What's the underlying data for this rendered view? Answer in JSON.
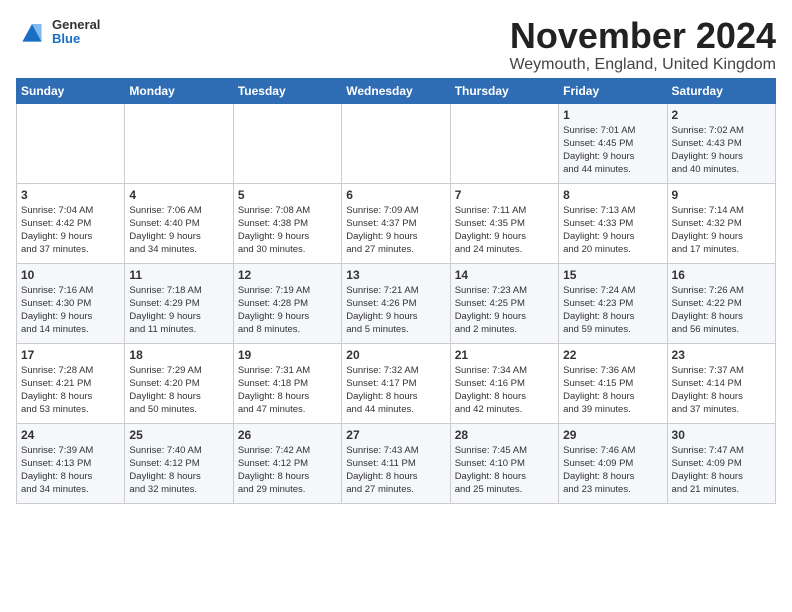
{
  "logo": {
    "general": "General",
    "blue": "Blue"
  },
  "header": {
    "month": "November 2024",
    "location": "Weymouth, England, United Kingdom"
  },
  "weekdays": [
    "Sunday",
    "Monday",
    "Tuesday",
    "Wednesday",
    "Thursday",
    "Friday",
    "Saturday"
  ],
  "rows": [
    [
      {
        "day": "",
        "info": ""
      },
      {
        "day": "",
        "info": ""
      },
      {
        "day": "",
        "info": ""
      },
      {
        "day": "",
        "info": ""
      },
      {
        "day": "",
        "info": ""
      },
      {
        "day": "1",
        "info": "Sunrise: 7:01 AM\nSunset: 4:45 PM\nDaylight: 9 hours\nand 44 minutes."
      },
      {
        "day": "2",
        "info": "Sunrise: 7:02 AM\nSunset: 4:43 PM\nDaylight: 9 hours\nand 40 minutes."
      }
    ],
    [
      {
        "day": "3",
        "info": "Sunrise: 7:04 AM\nSunset: 4:42 PM\nDaylight: 9 hours\nand 37 minutes."
      },
      {
        "day": "4",
        "info": "Sunrise: 7:06 AM\nSunset: 4:40 PM\nDaylight: 9 hours\nand 34 minutes."
      },
      {
        "day": "5",
        "info": "Sunrise: 7:08 AM\nSunset: 4:38 PM\nDaylight: 9 hours\nand 30 minutes."
      },
      {
        "day": "6",
        "info": "Sunrise: 7:09 AM\nSunset: 4:37 PM\nDaylight: 9 hours\nand 27 minutes."
      },
      {
        "day": "7",
        "info": "Sunrise: 7:11 AM\nSunset: 4:35 PM\nDaylight: 9 hours\nand 24 minutes."
      },
      {
        "day": "8",
        "info": "Sunrise: 7:13 AM\nSunset: 4:33 PM\nDaylight: 9 hours\nand 20 minutes."
      },
      {
        "day": "9",
        "info": "Sunrise: 7:14 AM\nSunset: 4:32 PM\nDaylight: 9 hours\nand 17 minutes."
      }
    ],
    [
      {
        "day": "10",
        "info": "Sunrise: 7:16 AM\nSunset: 4:30 PM\nDaylight: 9 hours\nand 14 minutes."
      },
      {
        "day": "11",
        "info": "Sunrise: 7:18 AM\nSunset: 4:29 PM\nDaylight: 9 hours\nand 11 minutes."
      },
      {
        "day": "12",
        "info": "Sunrise: 7:19 AM\nSunset: 4:28 PM\nDaylight: 9 hours\nand 8 minutes."
      },
      {
        "day": "13",
        "info": "Sunrise: 7:21 AM\nSunset: 4:26 PM\nDaylight: 9 hours\nand 5 minutes."
      },
      {
        "day": "14",
        "info": "Sunrise: 7:23 AM\nSunset: 4:25 PM\nDaylight: 9 hours\nand 2 minutes."
      },
      {
        "day": "15",
        "info": "Sunrise: 7:24 AM\nSunset: 4:23 PM\nDaylight: 8 hours\nand 59 minutes."
      },
      {
        "day": "16",
        "info": "Sunrise: 7:26 AM\nSunset: 4:22 PM\nDaylight: 8 hours\nand 56 minutes."
      }
    ],
    [
      {
        "day": "17",
        "info": "Sunrise: 7:28 AM\nSunset: 4:21 PM\nDaylight: 8 hours\nand 53 minutes."
      },
      {
        "day": "18",
        "info": "Sunrise: 7:29 AM\nSunset: 4:20 PM\nDaylight: 8 hours\nand 50 minutes."
      },
      {
        "day": "19",
        "info": "Sunrise: 7:31 AM\nSunset: 4:18 PM\nDaylight: 8 hours\nand 47 minutes."
      },
      {
        "day": "20",
        "info": "Sunrise: 7:32 AM\nSunset: 4:17 PM\nDaylight: 8 hours\nand 44 minutes."
      },
      {
        "day": "21",
        "info": "Sunrise: 7:34 AM\nSunset: 4:16 PM\nDaylight: 8 hours\nand 42 minutes."
      },
      {
        "day": "22",
        "info": "Sunrise: 7:36 AM\nSunset: 4:15 PM\nDaylight: 8 hours\nand 39 minutes."
      },
      {
        "day": "23",
        "info": "Sunrise: 7:37 AM\nSunset: 4:14 PM\nDaylight: 8 hours\nand 37 minutes."
      }
    ],
    [
      {
        "day": "24",
        "info": "Sunrise: 7:39 AM\nSunset: 4:13 PM\nDaylight: 8 hours\nand 34 minutes."
      },
      {
        "day": "25",
        "info": "Sunrise: 7:40 AM\nSunset: 4:12 PM\nDaylight: 8 hours\nand 32 minutes."
      },
      {
        "day": "26",
        "info": "Sunrise: 7:42 AM\nSunset: 4:12 PM\nDaylight: 8 hours\nand 29 minutes."
      },
      {
        "day": "27",
        "info": "Sunrise: 7:43 AM\nSunset: 4:11 PM\nDaylight: 8 hours\nand 27 minutes."
      },
      {
        "day": "28",
        "info": "Sunrise: 7:45 AM\nSunset: 4:10 PM\nDaylight: 8 hours\nand 25 minutes."
      },
      {
        "day": "29",
        "info": "Sunrise: 7:46 AM\nSunset: 4:09 PM\nDaylight: 8 hours\nand 23 minutes."
      },
      {
        "day": "30",
        "info": "Sunrise: 7:47 AM\nSunset: 4:09 PM\nDaylight: 8 hours\nand 21 minutes."
      }
    ]
  ]
}
